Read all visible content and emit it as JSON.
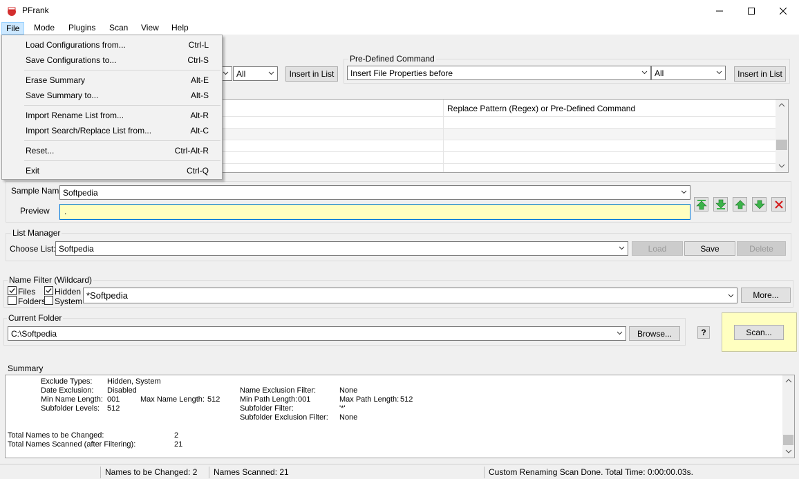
{
  "window": {
    "title": "PFrank"
  },
  "menubar": [
    {
      "label": "File"
    },
    {
      "label": "Mode"
    },
    {
      "label": "Plugins"
    },
    {
      "label": "Scan"
    },
    {
      "label": "View"
    },
    {
      "label": "Help"
    }
  ],
  "file_menu": [
    {
      "label": "Load Configurations from...",
      "shortcut": "Ctrl-L"
    },
    {
      "label": "Save Configurations to...",
      "shortcut": "Ctrl-S"
    },
    {
      "label": "Erase Summary",
      "shortcut": "Alt-E"
    },
    {
      "label": "Save Summary to...",
      "shortcut": "Alt-S"
    },
    {
      "label": "Import Rename List from...",
      "shortcut": "Alt-R"
    },
    {
      "label": "Import Search/Replace List from...",
      "shortcut": "Alt-C"
    },
    {
      "label": "Reset...",
      "shortcut": "Ctrl-Alt-R"
    },
    {
      "label": "Exit",
      "shortcut": "Ctrl-Q"
    }
  ],
  "left_command": {
    "filter_value": "All",
    "insert_label": "Insert in List"
  },
  "predefined": {
    "legend": "Pre-Defined Command",
    "command_value": "Insert File Properties before",
    "filter_value": "All",
    "insert_label": "Insert in List"
  },
  "grid": {
    "header_right": "Replace Pattern (Regex)  or  Pre-Defined Command"
  },
  "sample": {
    "name_label": "Sample Name",
    "name_value": "Softpedia",
    "preview_label": "Preview",
    "preview_value": "."
  },
  "list_manager": {
    "legend": "List Manager",
    "choose_label": "Choose List:",
    "choose_value": "Softpedia",
    "load_label": "Load",
    "save_label": "Save",
    "delete_label": "Delete"
  },
  "name_filter": {
    "legend": "Name Filter (Wildcard)",
    "files_label": "Files",
    "hidden_label": "Hidden",
    "folders_label": "Folders",
    "system_label": "System",
    "files_checked": true,
    "hidden_checked": true,
    "folders_checked": false,
    "system_checked": false,
    "filter_value": "*Softpedia",
    "more_label": "More..."
  },
  "current_folder": {
    "legend": "Current Folder",
    "path": "C:\\Softpedia",
    "browse_label": "Browse...",
    "help_label": "?",
    "scan_label": "Scan..."
  },
  "summary": {
    "legend": "Summary",
    "exclude_types_label": "Exclude Types:",
    "exclude_types_value": "Hidden, System",
    "date_exclusion_label": "Date Exclusion:",
    "date_exclusion_value": "Disabled",
    "min_name_label": "Min Name Length:",
    "min_name_value": "001",
    "max_name_label": "Max Name Length:",
    "max_name_value": "512",
    "subfolder_levels_label": "Subfolder Levels:",
    "subfolder_levels_value": "512",
    "name_excl_label": "Name Exclusion Filter:",
    "name_excl_value": "None",
    "min_path_label": "Min Path Length:",
    "min_path_value": "001",
    "max_path_label": "Max Path Length:",
    "max_path_value": "512",
    "subfolder_filter_label": "Subfolder Filter:",
    "subfolder_filter_value": "'*'",
    "subfolder_excl_label": "Subfolder Exclusion Filter:",
    "subfolder_excl_value": "None",
    "total_changed_label": "Total Names to be Changed:",
    "total_changed_value": "2",
    "total_scanned_label": "Total Names Scanned (after Filtering):",
    "total_scanned_value": "21"
  },
  "statusbar": {
    "changed": "Names to be Changed: 2",
    "scanned": "Names Scanned: 21",
    "message": "Custom Renaming Scan Done.  Total Time: 0:00:00.03s."
  },
  "colors": {
    "preview_bg": "#ffffc0",
    "scan_panel_bg": "#ffffc0",
    "arrow_green": "#3cb34a",
    "delete_red": "#d42020"
  }
}
